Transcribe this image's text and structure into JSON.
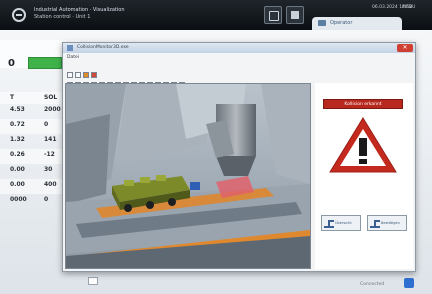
{
  "topbar": {
    "app_title": "Industrial Automation · Visualization",
    "app_subtitle": "Station control · Unit 1",
    "datetime": "06.03.2024  14:52",
    "menu_label": "MENU",
    "user_label": "Operator"
  },
  "background": {
    "count": "0",
    "table": {
      "headers": [
        "T",
        "SOL"
      ],
      "rows": [
        [
          "4.53",
          "2000"
        ],
        [
          "0.72",
          "0"
        ],
        [
          "1.32",
          "141"
        ],
        [
          "0.26",
          "-12"
        ],
        [
          "0.00",
          "30"
        ],
        [
          "0.00",
          "400"
        ],
        [
          "0000",
          "0"
        ]
      ]
    },
    "status_text": "Connected"
  },
  "window": {
    "title": "CollisionMonitor3D.exe",
    "menu": "Datei",
    "close_glyph": "✕"
  },
  "alert": {
    "alarm_label": "Kollision erkannt",
    "left_button_label": "Übersicht",
    "right_button_label": "Bestätigen"
  },
  "colors": {
    "accent_green": "#3fb34a",
    "alarm_red": "#b8281e",
    "warning_red": "#c4291d"
  },
  "icons": {
    "logo": "logo-icon",
    "warning": "warning-triangle-icon",
    "close": "close-icon"
  }
}
